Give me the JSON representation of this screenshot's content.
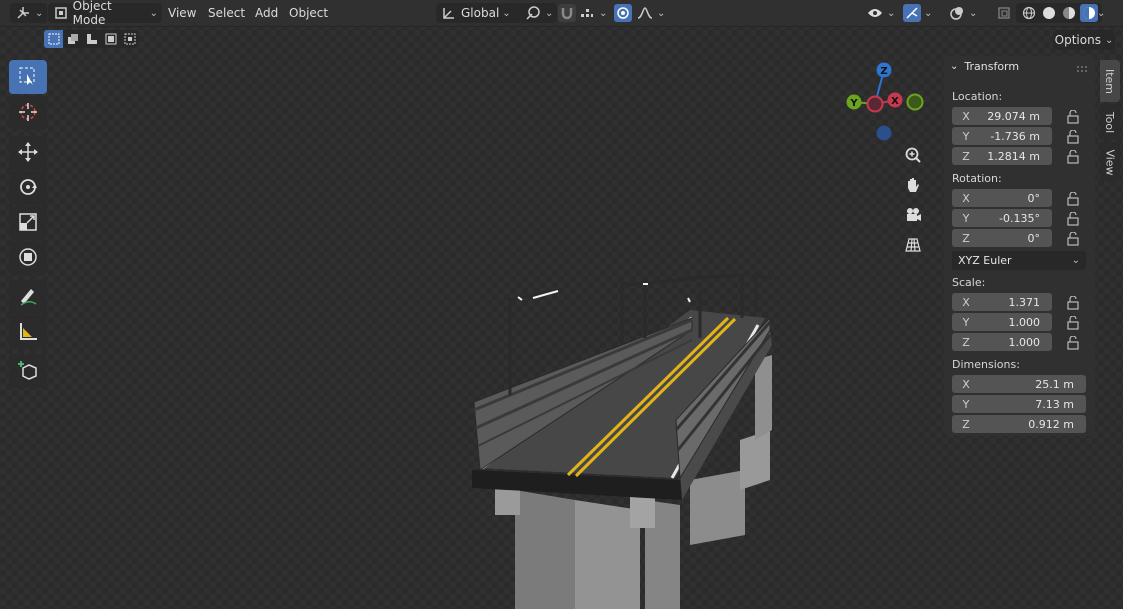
{
  "header": {
    "mode_label": "Object Mode",
    "menus": [
      "View",
      "Select",
      "Add",
      "Object"
    ],
    "orientation_label": "Global",
    "options_label": "Options"
  },
  "panel_tabs": [
    "Item",
    "Tool",
    "View"
  ],
  "transform": {
    "title": "Transform",
    "location_label": "Location:",
    "location": [
      {
        "axis": "X",
        "value": "29.074 m"
      },
      {
        "axis": "Y",
        "value": "-1.736 m"
      },
      {
        "axis": "Z",
        "value": "1.2814 m"
      }
    ],
    "rotation_label": "Rotation:",
    "rotation": [
      {
        "axis": "X",
        "value": "0°"
      },
      {
        "axis": "Y",
        "value": "-0.135°"
      },
      {
        "axis": "Z",
        "value": "0°"
      }
    ],
    "rotation_mode": "XYZ Euler",
    "scale_label": "Scale:",
    "scale": [
      {
        "axis": "X",
        "value": "1.371"
      },
      {
        "axis": "Y",
        "value": "1.000"
      },
      {
        "axis": "Z",
        "value": "1.000"
      }
    ],
    "dimensions_label": "Dimensions:",
    "dimensions": [
      {
        "axis": "X",
        "value": "25.1 m"
      },
      {
        "axis": "Y",
        "value": "7.13 m"
      },
      {
        "axis": "Z",
        "value": "0.912 m"
      }
    ]
  },
  "gizmo": {
    "x": "X",
    "y": "Y",
    "z": "Z"
  },
  "colors": {
    "accent": "#4772b3",
    "axis_x": "#c8394f",
    "axis_y": "#6aa51f",
    "axis_z": "#2f74d0"
  },
  "tools": [
    "select-box",
    "cursor",
    "move",
    "rotate",
    "scale",
    "transform",
    "annotate",
    "measure",
    "add-cube"
  ]
}
